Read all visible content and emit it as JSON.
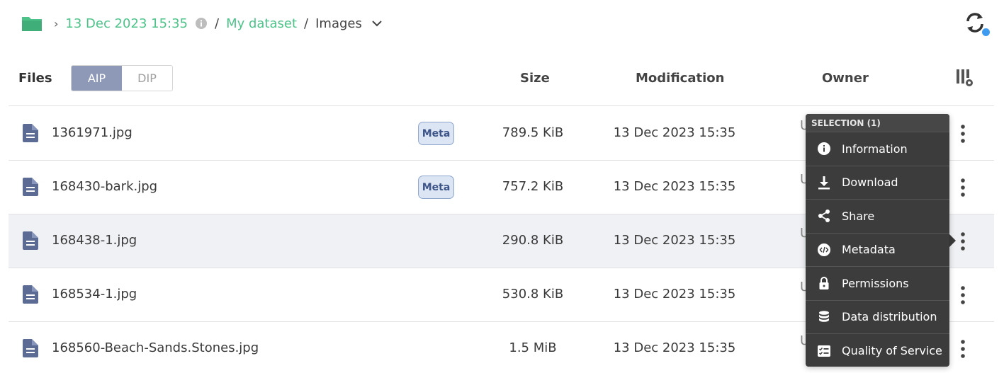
{
  "breadcrumb": {
    "root_icon": "folder-icon",
    "separator": "›",
    "items": [
      {
        "label": "13 Dec 2023 15:35"
      },
      {
        "label": "My dataset"
      },
      {
        "label": "Images"
      }
    ],
    "slash": "/"
  },
  "header": {
    "files_label": "Files",
    "mode_tabs": [
      {
        "label": "AIP",
        "active": true
      },
      {
        "label": "DIP",
        "active": false
      }
    ],
    "columns": {
      "size": "Size",
      "modification": "Modification",
      "owner": "Owner"
    }
  },
  "files": [
    {
      "name": "1361971.jpg",
      "badge": "Meta",
      "size": "789.5 KiB",
      "modified": "13 Dec 2023 15:35",
      "owner_peek": "U"
    },
    {
      "name": "168430-bark.jpg",
      "badge": "Meta",
      "size": "757.2 KiB",
      "modified": "13 Dec 2023 15:35",
      "owner_peek": "U"
    },
    {
      "name": "168438-1.jpg",
      "badge": "",
      "size": "290.8 KiB",
      "modified": "13 Dec 2023 15:35",
      "owner_peek": "U"
    },
    {
      "name": "168534-1.jpg",
      "badge": "",
      "size": "530.8 KiB",
      "modified": "13 Dec 2023 15:35",
      "owner_peek": "U"
    },
    {
      "name": "168560-Beach-Sands.Stones.jpg",
      "badge": "",
      "size": "1.5 MiB",
      "modified": "13 Dec 2023 15:35",
      "owner_peek": "U"
    }
  ],
  "context_menu": {
    "title": "SELECTION (1)",
    "items": [
      {
        "label": "Information",
        "icon": "info-icon"
      },
      {
        "label": "Download",
        "icon": "download-icon"
      },
      {
        "label": "Share",
        "icon": "share-icon"
      },
      {
        "label": "Metadata",
        "icon": "metadata-icon"
      },
      {
        "label": "Permissions",
        "icon": "lock-icon"
      },
      {
        "label": "Data distribution",
        "icon": "database-icon"
      },
      {
        "label": "Quality of Service",
        "icon": "checklist-icon"
      }
    ]
  },
  "colors": {
    "accent_green": "#4dc38a",
    "active_tab": "#8d99b7",
    "menu_bg": "#3c3c3c",
    "file_icon": "#5c6b94",
    "notify_dot": "#3e9bf0"
  }
}
